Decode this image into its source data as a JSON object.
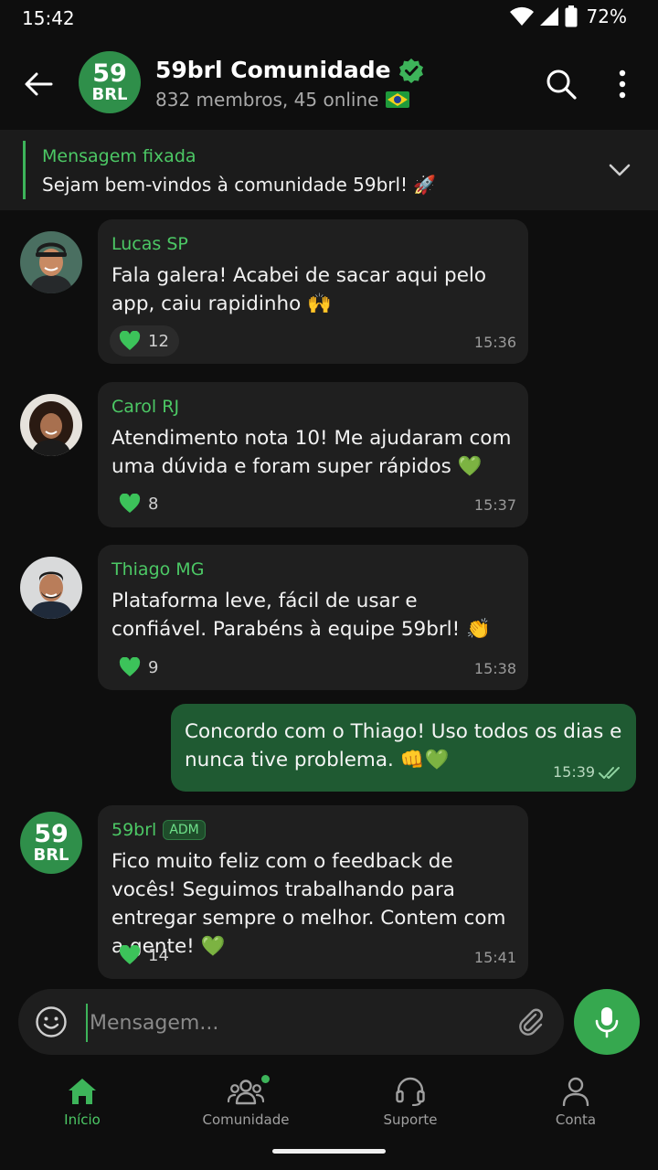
{
  "status": {
    "time": "15:42",
    "battery": "72%"
  },
  "header": {
    "avatar_line1": "59",
    "avatar_line2": "BRL",
    "title": "59brl Comunidade",
    "subtitle": "832 membros, 45 online"
  },
  "pinned": {
    "title": "Mensagem fixada",
    "text": "Sejam bem-vindos à comunidade 59brl! 🚀"
  },
  "messages": [
    {
      "sender": "Lucas SP",
      "text": "Fala galera! Acabei de sacar aqui pelo app, caiu rapidinho 🙌",
      "reaction_count": "12",
      "time": "15:36"
    },
    {
      "sender": "Carol RJ",
      "text": "Atendimento nota 10! Me ajudaram com uma dúvida e foram super rápidos 💚",
      "reaction_count": "8",
      "time": "15:37"
    },
    {
      "sender": "Thiago MG",
      "text": "Plataforma leve, fácil de usar e confiável. Parabéns à equipe 59brl! 👏",
      "reaction_count": "9",
      "time": "15:38"
    },
    {
      "sender": "59brl",
      "badge": "ADM",
      "avatar_line1": "59",
      "avatar_line2": "BRL",
      "text": "Fico muito feliz com o feedback de vocês! Seguimos trabalhando para entregar sempre o melhor. Contem com a gente! 💚",
      "reaction_count": "14",
      "time": "15:41"
    }
  ],
  "outgoing": {
    "text": "Concordo com o Thiago! Uso todos os dias e nunca tive problema. 👊💚",
    "time": "15:39"
  },
  "composer": {
    "placeholder": "Mensagem..."
  },
  "nav": [
    {
      "label": "Início",
      "icon": "home-icon",
      "active": true
    },
    {
      "label": "Comunidade",
      "icon": "community-icon"
    },
    {
      "label": "Suporte",
      "icon": "headset-icon"
    },
    {
      "label": "Conta",
      "icon": "user-icon"
    }
  ],
  "colors": {
    "accent": "#3db45a",
    "outgoing_bubble": "#1f5a32",
    "incoming_bubble": "#1f1f1f",
    "background": "#0e0e0e"
  }
}
